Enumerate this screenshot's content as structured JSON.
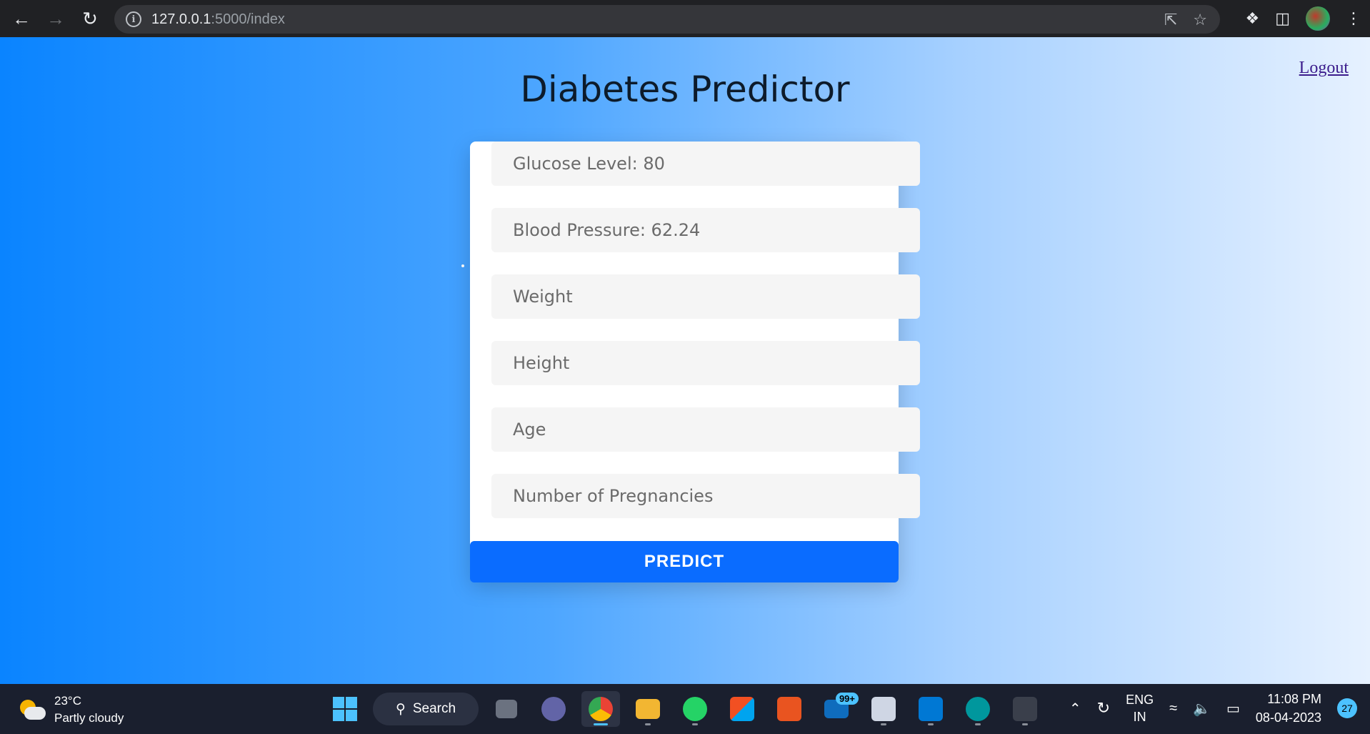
{
  "browser": {
    "url_host": "127.0.0.1",
    "url_path": ":5000/index"
  },
  "page": {
    "title": "Diabetes Predictor",
    "logout_label": "Logout",
    "fields": [
      {
        "label": "Glucose Level: 80"
      },
      {
        "label": "Blood Pressure: 62.24"
      },
      {
        "label": "Weight"
      },
      {
        "label": "Height"
      },
      {
        "label": "Age"
      },
      {
        "label": "Number of Pregnancies"
      }
    ],
    "predict_label": "PREDICT",
    "accent_color": "#0a6cff"
  },
  "taskbar": {
    "weather_temp": "23°C",
    "weather_desc": "Partly cloudy",
    "search_label": "Search",
    "mail_badge": "99+",
    "lang_line1": "ENG",
    "lang_line2": "IN",
    "time": "11:08 PM",
    "date": "08-04-2023",
    "notification_count": "27"
  }
}
